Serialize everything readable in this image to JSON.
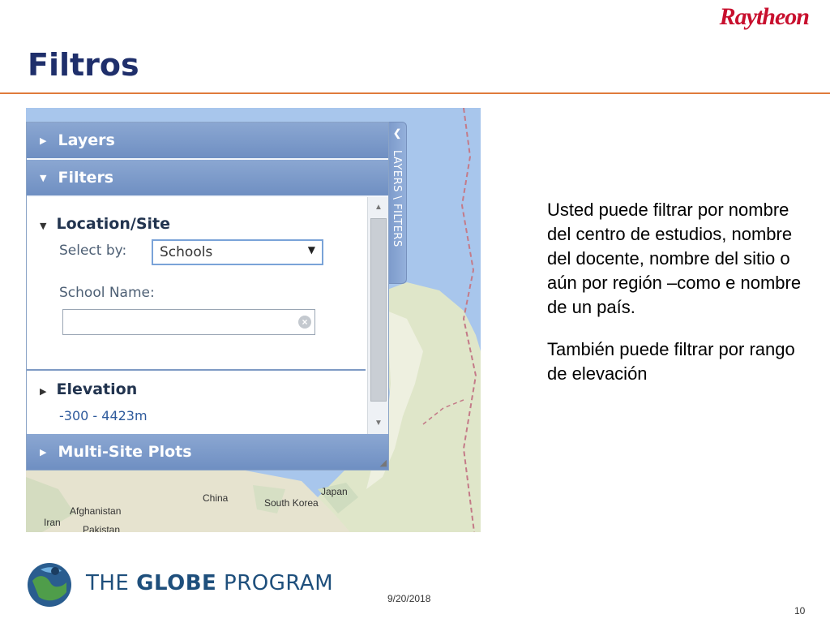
{
  "brand": "Raytheon",
  "slide": {
    "title": "Filtros",
    "description": [
      "Usted puede filtrar por nombre del centro de estudios, nombre del docente, nombre del sitio o aún por región –como e nombre de un país.",
      "También puede filtrar por rango de elevación"
    ]
  },
  "panel": {
    "side_tab_label": "LAYERS \\ FILTERS",
    "layers_label": "Layers",
    "filters_label": "Filters",
    "location_label": "Location/Site",
    "select_by_label": "Select by:",
    "select_by_value": "Schools",
    "school_name_label": "School Name:",
    "school_name_value": "",
    "elevation_label": "Elevation",
    "elevation_range": "-300 - 4423m",
    "multisite_label": "Multi-Site Plots"
  },
  "map_labels": {
    "china": "China",
    "afghanistan": "Afghanistan",
    "iran": "Iran",
    "pakistan": "Pakistan",
    "japan": "Japan",
    "south_korea": "South Korea"
  },
  "footer": {
    "program_prefix": "THE ",
    "program_bold": "GLOBE",
    "program_suffix": " PROGRAM",
    "date": "9/20/2018",
    "page": "10"
  },
  "colors": {
    "title": "#1f2f6b",
    "rule": "#e07b3c",
    "brand": "#c8102e",
    "panel_header": "#7b98c9"
  },
  "icons": [
    "collapse-triangle-icon",
    "expand-triangle-icon",
    "dropdown-arrow-icon",
    "clear-icon",
    "scroll-up-icon",
    "scroll-down-icon",
    "resize-grip-icon",
    "chevron-left-icon",
    "globe-logo-icon"
  ]
}
